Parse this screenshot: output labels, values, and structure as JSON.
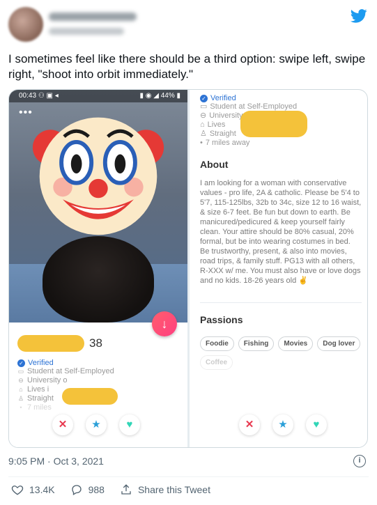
{
  "tweet": {
    "text": "I sometimes feel like there should be a third option: swipe left, swipe right, \"shoot into orbit immediately.\"",
    "timestamp": "9:05 PM · Oct 3, 2021",
    "likes": "13.4K",
    "replies": "988",
    "share_label": "Share this Tweet",
    "brand_color": "#1d9bf0"
  },
  "profile_card": {
    "status_time": "00:43",
    "battery": "44%",
    "menu_dots": "•••",
    "age": "38",
    "verified_label": "Verified",
    "left_lines": [
      "Student at Self-Employed",
      "University o",
      "Lives i",
      "Straight",
      "7 miles"
    ],
    "right_lines": [
      "Student at Self-Employed",
      "University of",
      "Lives",
      "Straight",
      "7 miles away"
    ],
    "about_title": "About",
    "about_text": "I am looking for a woman with conservative values - pro life, 2A & catholic. Please be 5'4 to 5'7, 115-125lbs, 32b to 34c, size 12 to 16 waist, & size 6-7 feet. Be fun but down to earth. Be manicured/pedicured & keep yourself fairly clean. Your attire should be 80% casual, 20% formal, but be into wearing costumes in bed. Be trustworthy, present, & also into movies, road trips, & family stuff. PG13 with all others, R-XXX w/ me. You must also have or love dogs and no kids. 18-26 years old ✌",
    "passions_title": "Passions",
    "passions": [
      "Foodie",
      "Fishing",
      "Movies",
      "Dog lover"
    ],
    "passion_faded": "Coffee",
    "colors": {
      "verified": "#2d73d4",
      "nope": "#e8384f",
      "superlike": "#2a9fd8",
      "like": "#31d6b7",
      "redact": "#f4c23a"
    }
  }
}
